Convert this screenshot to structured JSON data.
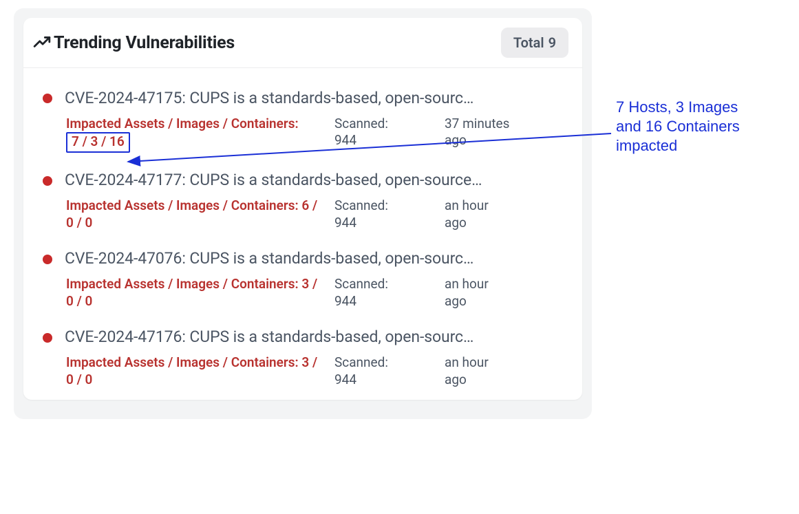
{
  "card": {
    "title": "Trending Vulnerabilities",
    "total_label": "Total",
    "total_value": "9"
  },
  "row_labels": {
    "impacted_prefix": "Impacted Assets / Images / Containers:",
    "scanned_label": "Scanned:"
  },
  "vulnerabilities": [
    {
      "severity_color": "#c92a2a",
      "title": "CVE-2024-47175: CUPS is a standards-based, open-sourc…",
      "impacted_counts": "7 / 3 / 16",
      "impacted_inline": false,
      "boxed": true,
      "scanned": "944",
      "time": "37 minutes ago"
    },
    {
      "severity_color": "#c92a2a",
      "title": "CVE-2024-47177: CUPS is a standards-based, open-source…",
      "impacted_counts": "6 / 0 / 0",
      "impacted_inline": true,
      "boxed": false,
      "scanned": "944",
      "time": "an hour ago"
    },
    {
      "severity_color": "#c92a2a",
      "title": "CVE-2024-47076: CUPS is a standards-based, open-sourc…",
      "impacted_counts": "3 / 0 / 0",
      "impacted_inline": true,
      "boxed": false,
      "scanned": "944",
      "time": "an hour ago"
    },
    {
      "severity_color": "#c92a2a",
      "title": "CVE-2024-47176: CUPS is a standards-based, open-sourc…",
      "impacted_counts": "3 / 0 / 0",
      "impacted_inline": true,
      "boxed": false,
      "scanned": "944",
      "time": "an hour ago"
    }
  ],
  "annotation": {
    "text_line1": "7 Hosts, 3 Images",
    "text_line2": "and 16 Containers",
    "text_line3": "impacted"
  }
}
